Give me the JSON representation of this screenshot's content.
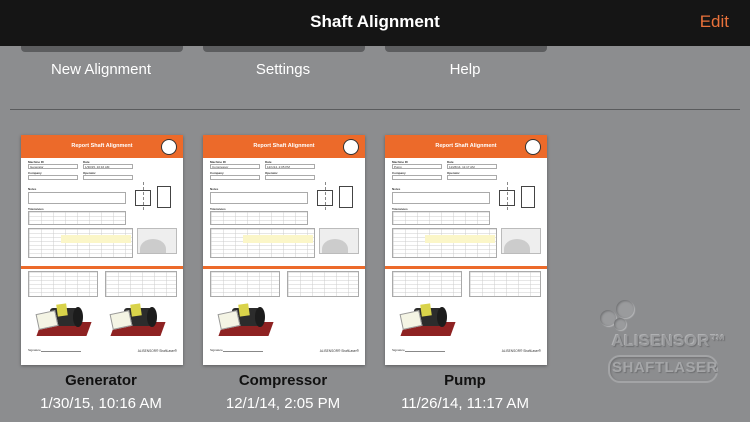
{
  "header": {
    "title": "Shaft Alignment",
    "edit_label": "Edit"
  },
  "actions": [
    {
      "label": "New Alignment"
    },
    {
      "label": "Settings"
    },
    {
      "label": "Help"
    }
  ],
  "reports": [
    {
      "name": "Generator",
      "date": "1/30/15, 10:16 AM",
      "doc_title": "Report Shaft Alignment",
      "machine": "Generator",
      "doc_date": "1/30/15, 10:16 AM"
    },
    {
      "name": "Compressor",
      "date": "12/1/14, 2:05 PM",
      "doc_title": "Report Shaft Alignment",
      "machine": "Compressor",
      "doc_date": "12/1/14, 2:05 PM"
    },
    {
      "name": "Pump",
      "date": "11/26/14, 11:17 AM",
      "doc_title": "Report Shaft Alignment",
      "machine": "Pump",
      "doc_date": "11/26/14, 11:17 AM"
    }
  ],
  "doc_labels": {
    "machine_id": "Machine ID",
    "date": "Date",
    "company": "Company",
    "operator": "Operator",
    "notes": "Notes",
    "tolerances": "Tolerances",
    "signature": "Signature",
    "brand": "ALISENSOR® ShaftLaser®"
  },
  "watermark": {
    "line1": "ALISENSOR™",
    "line2": "SHAFTLASER"
  },
  "colors": {
    "accent": "#e9713a",
    "doc_header": "#ec6a2a",
    "background": "#8c8d8f",
    "topbar": "#151515"
  }
}
